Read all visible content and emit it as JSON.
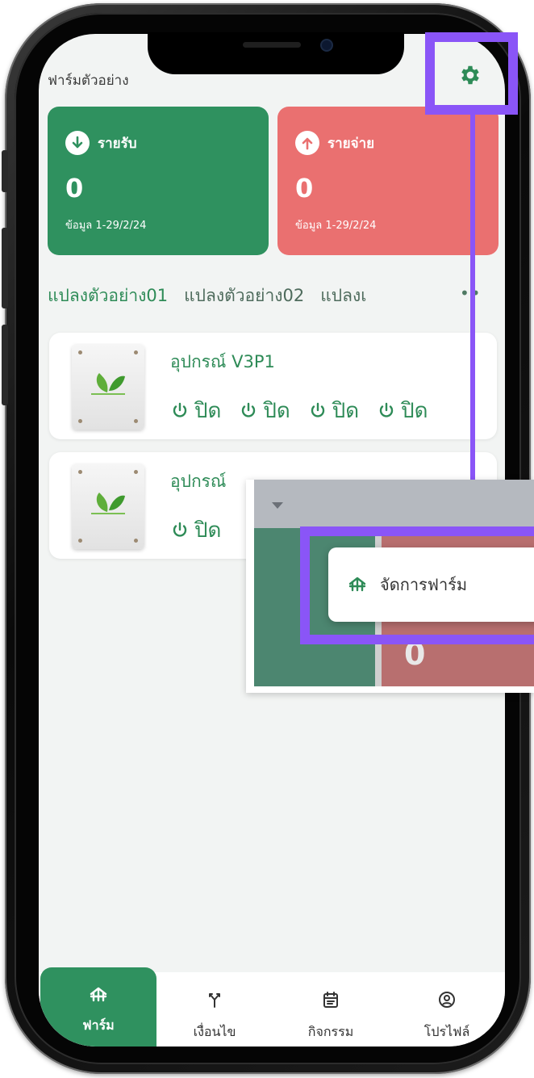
{
  "app": {
    "farm_name": "ฟาร์มตัวอย่าง"
  },
  "summary": {
    "income": {
      "label": "รายรับ",
      "value": "0",
      "period": "ข้อมูล 1-29/2/24",
      "color": "#2f915f"
    },
    "expense": {
      "label": "รายจ่าย",
      "value": "0",
      "period": "ข้อมูล 1-29/2/24",
      "color": "#ea7070"
    }
  },
  "plots": {
    "tabs": [
      "แปลงตัวอย่าง01",
      "แปลงตัวอย่าง02",
      "แปลงเ"
    ],
    "more": "••"
  },
  "devices": [
    {
      "name": "อุปกรณ์ V3P1",
      "switches": [
        "ปิด",
        "ปิด",
        "ปิด",
        "ปิด"
      ]
    },
    {
      "name": "อุปกรณ์",
      "switches": [
        "ปิด"
      ]
    }
  ],
  "bottom_nav": {
    "items": [
      {
        "label": "ฟาร์ม",
        "icon": "farm-icon",
        "active": true
      },
      {
        "label": "เงื่อนไข",
        "icon": "branch-icon",
        "active": false
      },
      {
        "label": "กิจกรรม",
        "icon": "calendar-icon",
        "active": false
      },
      {
        "label": "โปรไฟล์",
        "icon": "profile-icon",
        "active": false
      }
    ]
  },
  "zoom_inset": {
    "menu_item": "จัดการฟาร์ม",
    "card_value": "0"
  },
  "colors": {
    "accent_green": "#2e8b57",
    "annotation_purple": "#8a55f7"
  }
}
